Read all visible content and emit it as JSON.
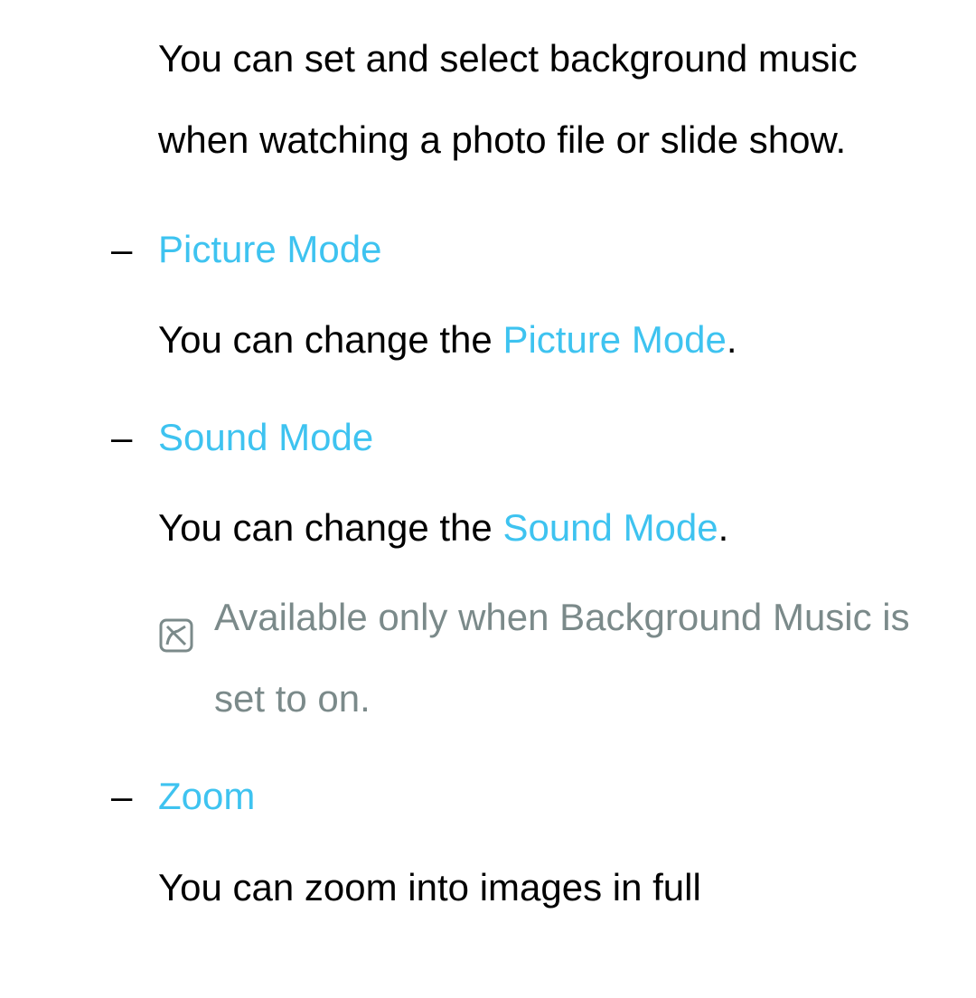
{
  "intro": "You can set and select background music when watching a photo file or slide show.",
  "items": [
    {
      "dash": "–",
      "title": "Picture Mode",
      "body_prefix": "You can change the ",
      "body_term": "Picture Mode",
      "body_suffix": "."
    },
    {
      "dash": "–",
      "title": "Sound Mode",
      "body_prefix": "You can change the ",
      "body_term": "Sound Mode",
      "body_suffix": ".",
      "note": "Available only when Background Music is set to on."
    },
    {
      "dash": "–",
      "title": "Zoom",
      "body_plain": "You can zoom into images in full"
    }
  ]
}
